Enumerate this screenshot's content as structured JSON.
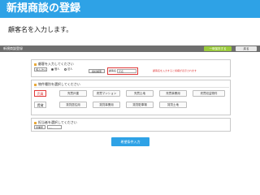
{
  "slide": {
    "title": "新規商談の登録",
    "instruction": "顧客名を入力します。"
  },
  "app": {
    "header_title": "新規商談登録",
    "save_temp_label": "一時保存する",
    "back_label": "戻る"
  },
  "customer_section": {
    "heading": "顧客を入力してください",
    "kind_select": "個人/法人",
    "radio_options": [
      {
        "label": "個人",
        "selected": true
      },
      {
        "label": "法人",
        "selected": false
      }
    ],
    "company_button": "会社検索",
    "customer_label": "顧客名",
    "customer_placeholder": "氏名",
    "note": "顧客名を入力すると候補が表示されます"
  },
  "type_section": {
    "heading": "物件種別を選択してください",
    "rows": [
      {
        "category": "売買",
        "options": [
          "売買戸建",
          "売買マンション",
          "売買土地",
          "売買事業用",
          "売買収益物件"
        ]
      },
      {
        "category": "賃貸",
        "options": [
          "賃貸居住用",
          "賃貸事業用",
          "賃貸駐車場",
          "賃貸土地"
        ]
      }
    ]
  },
  "staff_section": {
    "heading": "担当者を選択してください",
    "office_select": "営業所",
    "staff_select": "----"
  },
  "next_button": "希望条件入力",
  "colors": {
    "brand_blue": "#2ea2e6",
    "accent_green": "#9aca3c",
    "alert_red": "#e03a3a"
  }
}
